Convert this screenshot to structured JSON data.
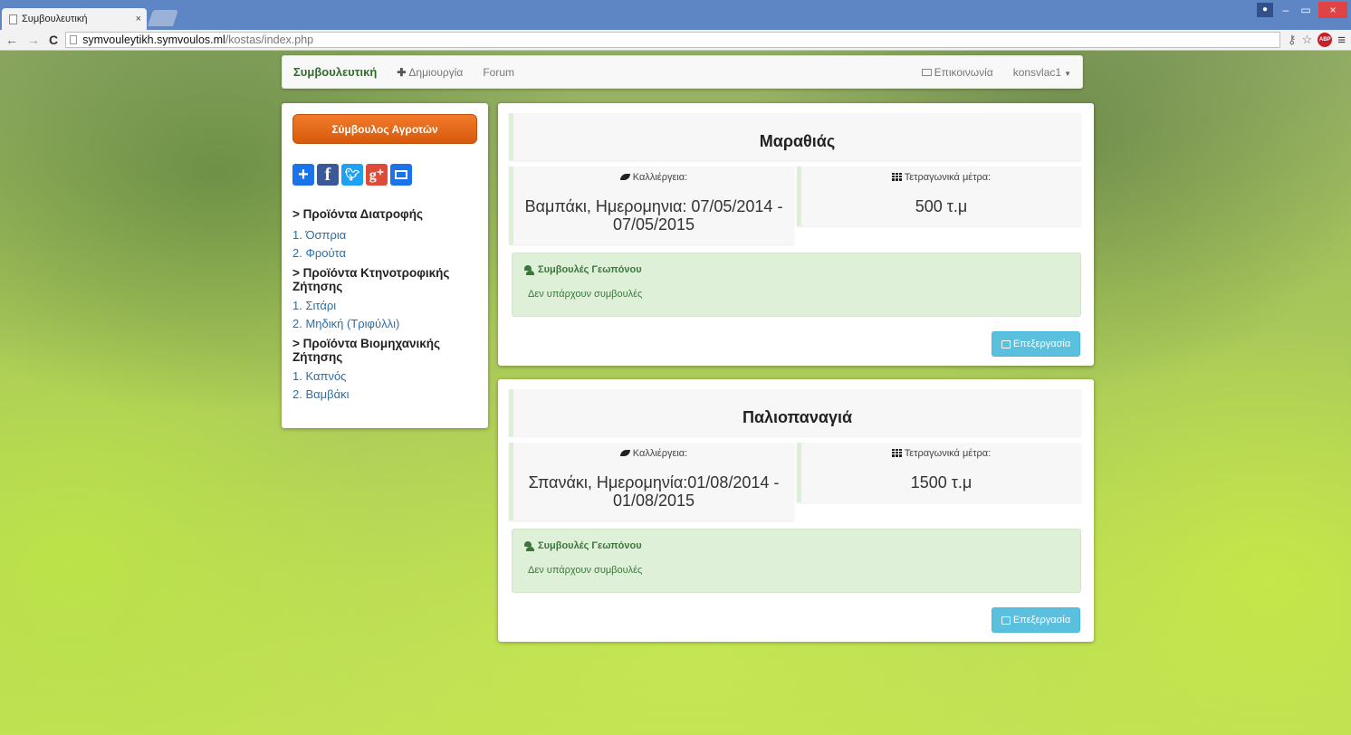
{
  "browser": {
    "tab_title": "Συμβουλευτική",
    "tab_close": "×",
    "url_host": "symvouleytikh.symvoulos.ml",
    "url_path": "/kostas/index.php",
    "back": "←",
    "forward": "→",
    "reload": "C",
    "minimize": "–",
    "restore": "▭",
    "close": "×",
    "menu": "≡",
    "abp_label": "ABP"
  },
  "navbar": {
    "brand": "Συμβουλευτική",
    "create": "Δημιουργία",
    "forum": "Forum",
    "contact": "Επικοινωνία",
    "user": "konsvlac1"
  },
  "sidebar": {
    "button": "Σύμβουλος Αγροτών",
    "share_icons": [
      "add-icon",
      "facebook-icon",
      "twitter-icon",
      "google-plus-icon",
      "mail-icon"
    ],
    "categories": [
      {
        "title": "> Προϊόντα Διατροφής",
        "items": [
          "1. Όσπρια",
          "2. Φρούτα"
        ]
      },
      {
        "title": "> Προϊόντα Κτηνοτροφικής Ζήτησης",
        "items": [
          "1. Σιτάρι",
          "2. Μηδική (Τριφύλλι)"
        ]
      },
      {
        "title": "> Προϊόντα Βιομηχανικής Ζήτησης",
        "items": [
          "1. Καπνός",
          "2. Βαμβάκι"
        ]
      }
    ]
  },
  "fields": [
    {
      "title": "Μαραθιάς",
      "crop_label": "Καλλιέργεια:",
      "crop_value": "Βαμπάκι, Ημερομηνια: 07/05/2014 - 07/05/2015",
      "area_label": "Τετραγωνικά μέτρα:",
      "area_value": "500 τ.μ",
      "advice_title": "Συμβουλές Γεωπόνου",
      "advice_text": "Δεν υπάρχουν συμβουλές",
      "edit": "Επεξεργασία"
    },
    {
      "title": "Παλιοπαναγιά",
      "crop_label": "Καλλιέργεια:",
      "crop_value": "Σπανάκι, Ημερομηνία:01/08/2014 - 01/08/2015",
      "area_label": "Τετραγωνικά μέτρα:",
      "area_value": "1500 τ.μ",
      "advice_title": "Συμβουλές Γεωπόνου",
      "advice_text": "Δεν υπάρχουν συμβουλές",
      "edit": "Επεξεργασία"
    }
  ],
  "colors": {
    "brand_green": "#2f6d2c",
    "orange_button": "#e5661a",
    "edit_button": "#5bc0de",
    "advice_bg": "#dff0d8",
    "link_blue": "#2a6fa8"
  }
}
